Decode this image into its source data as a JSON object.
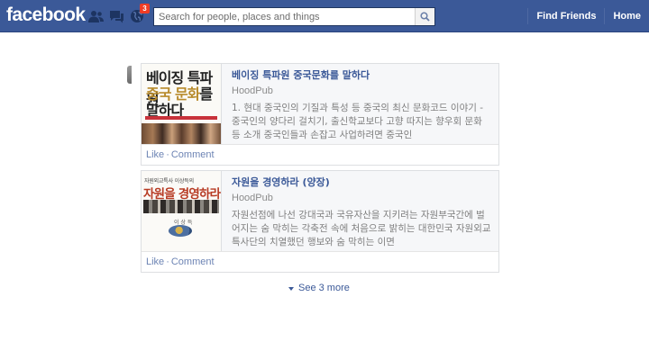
{
  "header": {
    "logo": "facebook",
    "search_placeholder": "Search for people, places and things",
    "notifications_count": "3",
    "nav": [
      "Find Friends",
      "Home"
    ]
  },
  "stories": [
    {
      "title": "베이징 특파원 중국문화를 말하다",
      "source": "HoodPub",
      "description": "1. 현대 중국인의 기질과 특성 등 중국의 최신 문화코드 이야기 - 중국인의 양다리 걸치기, 출신학교보다 고향 따지는 향우회 문화 등 소개 중국인들과 손잡고 사업하려면 중국인",
      "cover": {
        "line1": "베이징 특파원",
        "line2": "중국 문화",
        "line2_tail": "를",
        "line3": "말하다"
      },
      "actions": {
        "like": "Like",
        "comment": "Comment"
      }
    },
    {
      "title": "자원을 경영하라 (양장)",
      "source": "HoodPub",
      "description": "자원선점에 나선 강대국과 국유자산을 지키려는 자원부국간에 벌어지는 숨 막히는 각축전 속에 처음으로 밝히는 대한민국 자원외교 특사단의 치열했던 행보와 숨 막히는 이면",
      "cover": {
        "top": "자원외교특사 이상득의",
        "main": "자원을 경영하라",
        "author": "이 상 득"
      },
      "actions": {
        "like": "Like",
        "comment": "Comment"
      }
    }
  ],
  "see_more": "See 3 more",
  "colors": {
    "brand": "#3b5998",
    "link": "#6d84b4",
    "badge": "#f03d25"
  }
}
